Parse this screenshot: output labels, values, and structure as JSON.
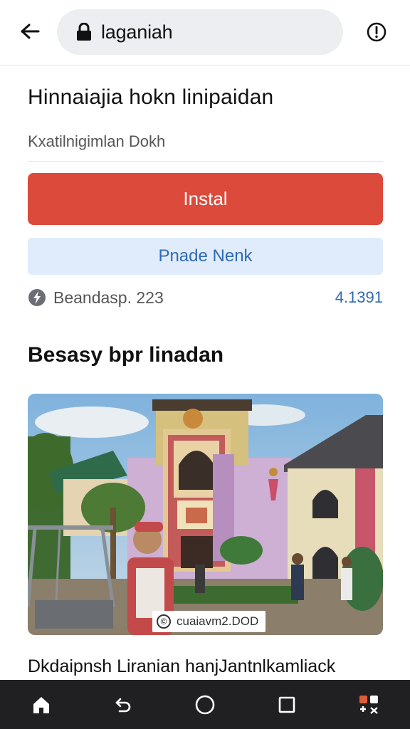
{
  "browser": {
    "url_text": "laganiah"
  },
  "page": {
    "title": "Hinnaiajia hokn linipaidan",
    "subtitle": "Kxatilnigimlan Dokh",
    "install_label": "Instal",
    "secondary_label": "Pnade Nenk",
    "status_text": "Beandasp. 223",
    "status_number": "4.1391",
    "section_heading": "Besasy bpr linadan",
    "photo_caption": "cuaiavm2.DOD",
    "bottom_text": "Dkdaipnsh Liranian hanjJantnlkamliack"
  },
  "icons": {
    "back": "back-arrow-icon",
    "lock": "lock-icon",
    "menu": "info-circle-icon",
    "status": "bolt-badge-icon",
    "caption": "copyright-icon",
    "nav": [
      "home-icon",
      "back-nav-icon",
      "circle-home-icon",
      "recents-icon",
      "apps-icon"
    ]
  },
  "colors": {
    "install": "#dc4a3b",
    "secondary_bg": "#e0ecfb",
    "link": "#2f6ab3",
    "navbar": "#202022"
  }
}
